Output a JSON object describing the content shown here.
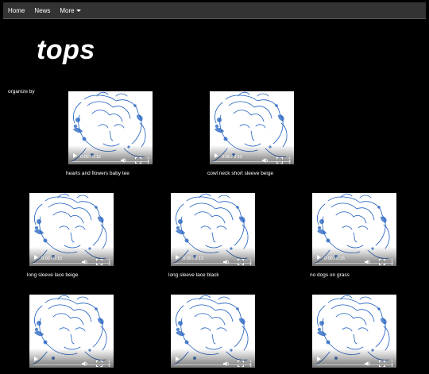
{
  "nav": {
    "items": [
      {
        "label": "Home"
      },
      {
        "label": "News"
      },
      {
        "label": "More"
      }
    ]
  },
  "page": {
    "title": "tops",
    "organize_label": "organize by"
  },
  "videos": [
    {
      "caption": "hearts and flowers baby tee",
      "time": "0:00 / 0:12"
    },
    {
      "caption": "cowl neck short sleeve beige",
      "time": "0:00 / 0:12"
    },
    {
      "caption": "long sleeve lace beige",
      "time": "0:00 / 0:15"
    },
    {
      "caption": "long sleeve lace black",
      "time": "0:00 / 0:13"
    },
    {
      "caption": "no dogs on grass",
      "time": "0:00 / 0:15"
    },
    {
      "caption": "",
      "time": ""
    },
    {
      "caption": "",
      "time": ""
    },
    {
      "caption": "",
      "time": ""
    }
  ],
  "colors": {
    "background": "#000000",
    "navbar": "#333333",
    "art_stroke": "#1f5fbf"
  },
  "icons": {
    "play": "play-icon",
    "volume": "volume-icon",
    "fullscreen": "fullscreen-icon",
    "menu": "more-options-icon",
    "dropdown": "chevron-down-icon"
  }
}
